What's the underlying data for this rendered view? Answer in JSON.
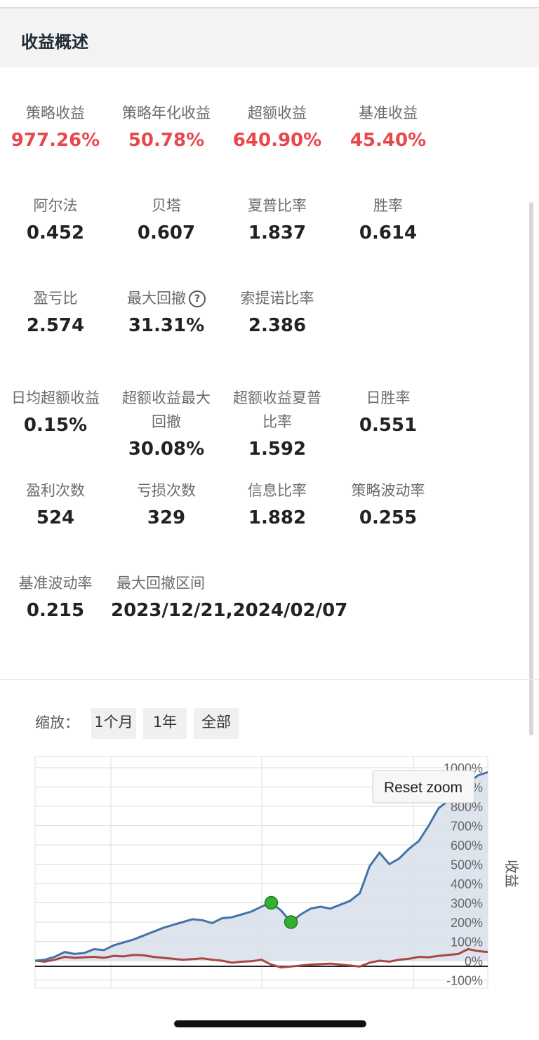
{
  "header": {
    "title": "收益概述"
  },
  "metrics": {
    "strategy_return": {
      "label": "策略收益",
      "value": "977.26%"
    },
    "annual_return": {
      "label": "策略年化收益",
      "value": "50.78%"
    },
    "excess_return": {
      "label": "超额收益",
      "value": "640.90%"
    },
    "benchmark_return": {
      "label": "基准收益",
      "value": "45.40%"
    },
    "alpha": {
      "label": "阿尔法",
      "value": "0.452"
    },
    "beta": {
      "label": "贝塔",
      "value": "0.607"
    },
    "sharpe": {
      "label": "夏普比率",
      "value": "1.837"
    },
    "win_rate": {
      "label": "胜率",
      "value": "0.614"
    },
    "pl_ratio": {
      "label": "盈亏比",
      "value": "2.574"
    },
    "max_drawdown": {
      "label": "最大回撤",
      "value": "31.31%",
      "help_icon": "?"
    },
    "sortino": {
      "label": "索提诺比率",
      "value": "2.386"
    },
    "daily_excess": {
      "label": "日均超额收益",
      "value": "0.15%"
    },
    "excess_mdd": {
      "label_line1": "超额收益最大",
      "label_line2": "回撤",
      "value": "30.08%"
    },
    "excess_sharpe": {
      "label_line1": "超额收益夏普",
      "label_line2": "比率",
      "value": "1.592"
    },
    "daily_win_rate": {
      "label": "日胜率",
      "value": "0.551"
    },
    "profit_count": {
      "label": "盈利次数",
      "value": "524"
    },
    "loss_count": {
      "label": "亏损次数",
      "value": "329"
    },
    "info_ratio": {
      "label": "信息比率",
      "value": "1.882"
    },
    "strategy_vol": {
      "label": "策略波动率",
      "value": "0.255"
    },
    "benchmark_vol": {
      "label": "基准波动率",
      "value": "0.215"
    },
    "mdd_period": {
      "label": "最大回撤区间",
      "value": "2023/12/21,2024/02/07"
    }
  },
  "zoom": {
    "label": "缩放：",
    "buttons": [
      "1个月",
      "1年",
      "全部"
    ]
  },
  "chart_data": {
    "type": "area",
    "ylabel": "收益",
    "y_ticks": [
      "1000%",
      "900%",
      "800%",
      "700%",
      "600%",
      "500%",
      "400%",
      "300%",
      "200%",
      "100%",
      "0%",
      "-100%"
    ],
    "ylim": [
      -100,
      1100
    ],
    "reset_zoom_label": "Reset zoom",
    "colors": {
      "strategy": "#4572a7",
      "benchmark": "#aa4643",
      "fill": "#d9e1ec",
      "marker": "#33b033"
    },
    "series": [
      {
        "key": "strategy",
        "values": [
          0,
          5,
          20,
          45,
          35,
          40,
          60,
          55,
          80,
          95,
          110,
          130,
          150,
          170,
          185,
          200,
          215,
          210,
          195,
          220,
          225,
          240,
          255,
          280,
          300,
          260,
          200,
          240,
          270,
          280,
          270,
          290,
          310,
          350,
          490,
          560,
          500,
          530,
          580,
          620,
          700,
          790,
          830,
          880,
          920,
          960,
          977
        ]
      },
      {
        "key": "benchmark",
        "values": [
          0,
          -5,
          5,
          20,
          15,
          18,
          20,
          15,
          25,
          22,
          30,
          28,
          20,
          15,
          10,
          5,
          8,
          12,
          5,
          0,
          -10,
          -5,
          -3,
          5,
          -20,
          -35,
          -30,
          -25,
          -20,
          -18,
          -15,
          -20,
          -25,
          -30,
          -10,
          0,
          -5,
          5,
          10,
          20,
          18,
          25,
          30,
          35,
          60,
          50,
          45
        ]
      }
    ],
    "markers": [
      {
        "index": 24,
        "value": 300
      },
      {
        "index": 26,
        "value": 200
      }
    ]
  }
}
